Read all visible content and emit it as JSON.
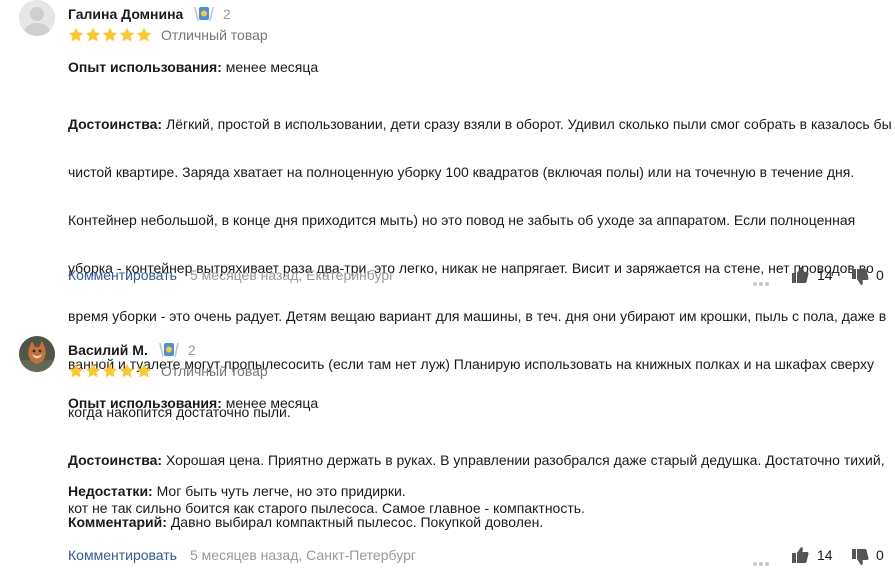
{
  "reviews": [
    {
      "author": "Галина Домнина",
      "badge_count": "2",
      "rating_label": "Отличный товар",
      "experience_label": "Опыт использования:",
      "experience_value": "менее месяца",
      "pros_label": "Достоинства:",
      "pros_lines": [
        "Лёгкий, простой в использовании, дети сразу взяли в оборот. Удивил сколько пыли смог собрать в казалось бы",
        "чистой квартире. Заряда хватает на полноценную уборку 100 квадратов (включая полы) или на точечную в течение дня.",
        "Контейнер небольшой, в конце дня приходится мыть) но это повод не забыть об уходе за аппаратом. Если полноценная",
        "уборка - контейнер вытряхивает раза два-три, это легко, никак не напрягает. Висит и заряжается на стене, нет проводов во",
        "время уборки - это очень радует. Детям вещаю вариант для машины, в теч. дня они убирают им крошки, пыль с пола, даже в",
        "ванной и туалете могут пропылесосить (если там нет луж) Планирую использовать на книжных полках и на шкафах сверху",
        "когда накопится достаточно пыли."
      ],
      "comment_link": "Комментировать",
      "meta": "5 месяцев назад, Екатеринбург",
      "likes": "14",
      "dislikes": "0"
    },
    {
      "author": "Василий М.",
      "badge_count": "2",
      "rating_label": "Отличный товар",
      "experience_label": "Опыт использования:",
      "experience_value": "менее месяца",
      "pros_label": "Достоинства:",
      "pros_lines": [
        "Хорошая цена. Приятно держать в руках. В управлении разобрался даже старый дедушка. Достаточно тихий,",
        "кот не так сильно боится как старого пылесоса. Самое главное - компактность."
      ],
      "cons_label": "Недостатки:",
      "cons_value": "Мог быть чуть легче, но это придирки.",
      "comment_label": "Комментарий:",
      "comment_value": "Давно выбирал компактный пылесос. Покупкой доволен.",
      "comment_link": "Комментировать",
      "meta": "5 месяцев назад, Санкт-Петербург",
      "likes": "14",
      "dislikes": "0"
    }
  ],
  "colors": {
    "star": "#ffc72c",
    "link": "#2c5aa6",
    "muted": "#999999",
    "badge": "#4a90e2"
  },
  "icons": [
    "avatar-placeholder-icon",
    "cat-avatar-photo",
    "expert-badge-icon",
    "star-icon",
    "more-dots-icon",
    "thumbs-up-icon",
    "thumbs-down-icon"
  ]
}
